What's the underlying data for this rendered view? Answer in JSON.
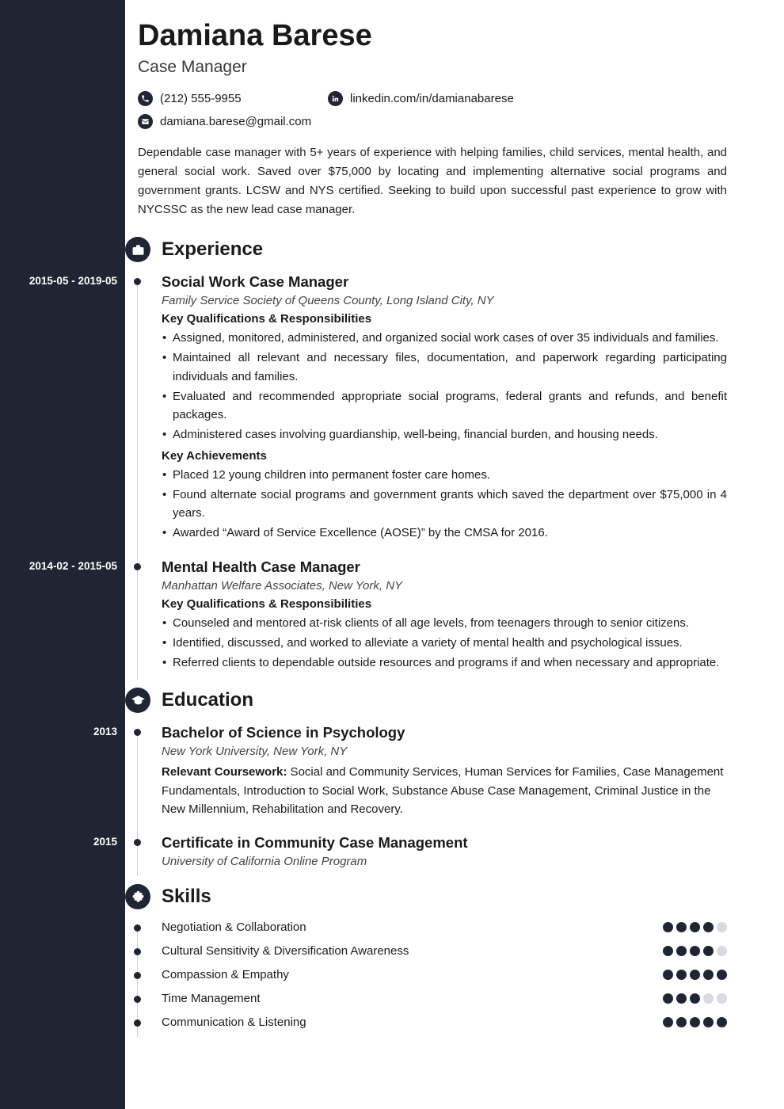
{
  "header": {
    "name": "Damiana Barese",
    "title": "Case Manager"
  },
  "contacts": {
    "phone": "(212) 555-9955",
    "linkedin": "linkedin.com/in/damianabarese",
    "email": "damiana.barese@gmail.com"
  },
  "summary": "Dependable case manager with 5+ years of experience with helping families, child services, mental health, and general social work. Saved over $75,000 by locating and implementing alternative social programs and government grants. LCSW and NYS certified. Seeking to build upon successful past experience to grow with NYCSSC as the new lead case manager.",
  "sections": {
    "experience": "Experience",
    "education": "Education",
    "skills": "Skills"
  },
  "experience": [
    {
      "dates": "2015-05 - 2019-05",
      "title": "Social Work Case Manager",
      "org": "Family Service Society of Queens County, Long Island City, NY",
      "resp_heading": "Key Qualifications & Responsibilities",
      "responsibilities": [
        "Assigned, monitored, administered, and organized social work cases of over 35 individuals and families.",
        "Maintained all relevant and necessary files, documentation, and paperwork regarding participating individuals and families.",
        "Evaluated and recommended appropriate social programs, federal grants and refunds, and benefit packages.",
        "Administered cases involving guardianship, well-being, financial burden, and housing needs."
      ],
      "ach_heading": "Key Achievements",
      "achievements": [
        "Placed 12 young children into permanent foster care homes.",
        "Found alternate social programs and government grants which saved the department over $75,000 in 4 years.",
        "Awarded “Award of Service Excellence (AOSE)” by the CMSA for 2016."
      ]
    },
    {
      "dates": "2014-02 - 2015-05",
      "title": "Mental Health Case Manager",
      "org": "Manhattan Welfare Associates, New York, NY",
      "resp_heading": "Key Qualifications & Responsibilities",
      "responsibilities": [
        "Counseled and mentored at-risk clients of all age levels, from teenagers through to senior citizens.",
        "Identified, discussed, and worked to alleviate a variety of mental health and psychological issues.",
        "Referred clients to dependable outside resources and programs if and when necessary and appropriate."
      ]
    }
  ],
  "education": [
    {
      "dates": "2013",
      "title": "Bachelor of Science in Psychology",
      "org": "New York University, New York, NY",
      "body_lead": "Relevant Coursework:",
      "body_rest": " Social and Community Services, Human Services for Families, Case Management Fundamentals, Introduction to Social Work, Substance Abuse Case Management, Criminal Justice in the New Millennium, Rehabilitation and Recovery."
    },
    {
      "dates": "2015",
      "title": "Certificate in Community Case Management",
      "org": "University of California Online Program"
    }
  ],
  "skills": [
    {
      "name": "Negotiation & Collaboration",
      "level": 4
    },
    {
      "name": "Cultural Sensitivity & Diversification Awareness",
      "level": 4
    },
    {
      "name": "Compassion & Empathy",
      "level": 5
    },
    {
      "name": "Time Management",
      "level": 3
    },
    {
      "name": "Communication & Listening",
      "level": 5
    }
  ]
}
